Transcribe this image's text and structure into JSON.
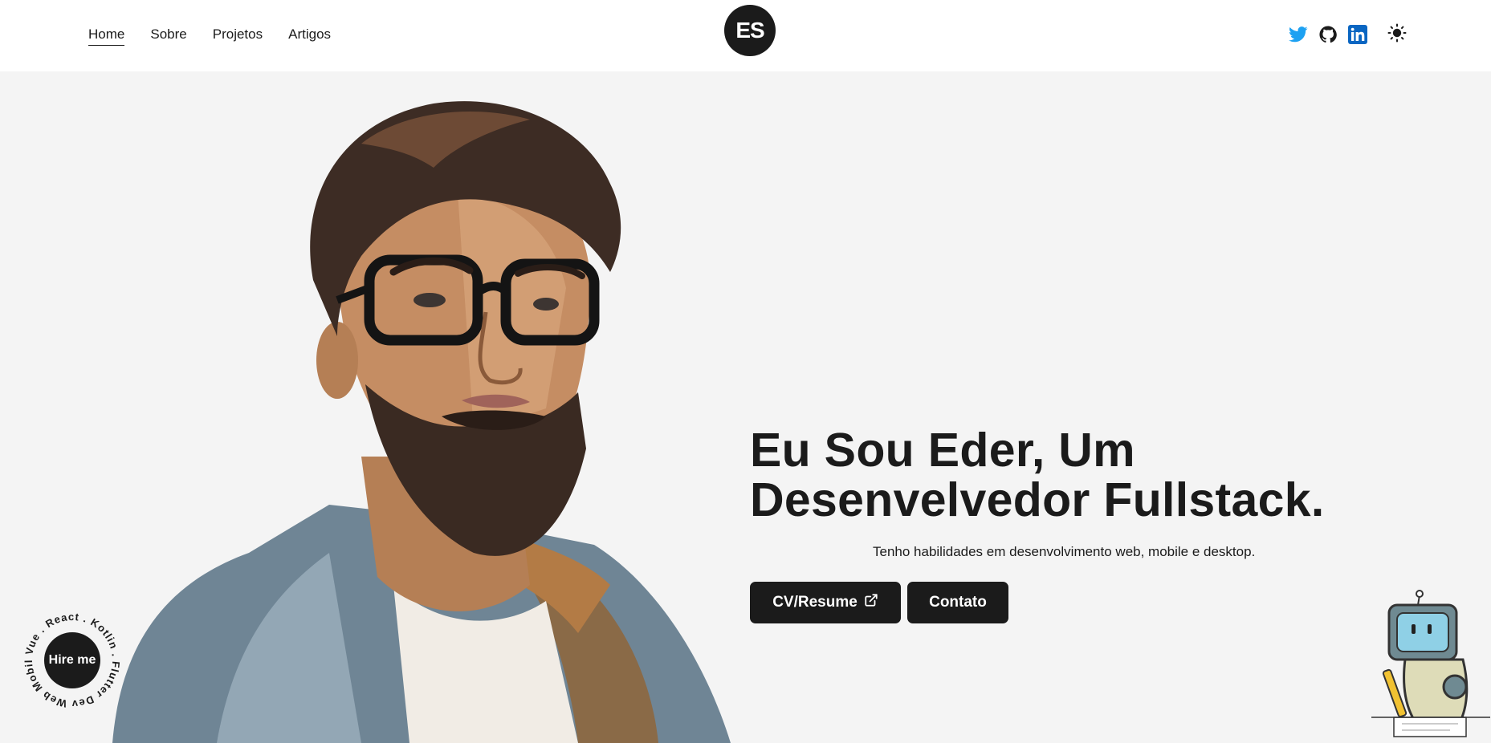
{
  "nav": {
    "items": [
      {
        "label": "Home",
        "active": true
      },
      {
        "label": "Sobre",
        "active": false
      },
      {
        "label": "Projetos",
        "active": false
      },
      {
        "label": "Artigos",
        "active": false
      }
    ]
  },
  "logo": {
    "text": "ES"
  },
  "socials": {
    "icons": [
      "twitter-icon",
      "github-icon",
      "linkedin-icon"
    ],
    "colors": {
      "twitter": "#1da1f2",
      "github": "#1b1b1b",
      "linkedin": "#0a66c2"
    }
  },
  "theme_toggle": {
    "icon": "sun-icon"
  },
  "hero": {
    "headline_line1": "Eu Sou Eder, Um",
    "headline_line2": "Desenvelvedor Fullstack.",
    "tagline": "Tenho habilidades em desenvolvimento web, mobile e desktop.",
    "cv_button": "CV/Resume",
    "contact_button": "Contato"
  },
  "hire": {
    "label": "Hire me",
    "ring_text": "Vue . React . Kotlin . Flutter Dev Web Mobile ."
  },
  "colors": {
    "background": "#f4f4f4",
    "header": "#ffffff",
    "primary": "#1b1b1b"
  }
}
